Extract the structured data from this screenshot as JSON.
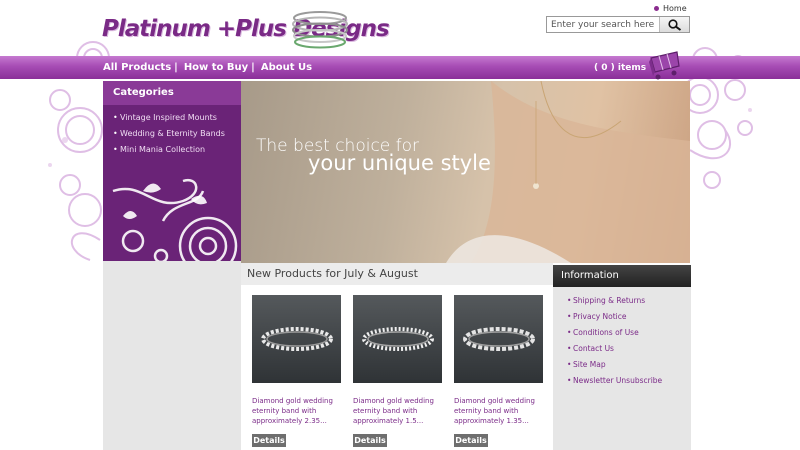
{
  "header": {
    "logo_text": "Platinum +Plus Designs",
    "home_link": "Home",
    "search_placeholder": "Enter your search here"
  },
  "nav": {
    "items": [
      {
        "label": "All Products"
      },
      {
        "label": "How to Buy"
      },
      {
        "label": "About Us"
      }
    ],
    "separator": "|",
    "cart_label": "( 0 ) items"
  },
  "categories": {
    "title": "Categories",
    "items": [
      {
        "label": "Vintage Inspired Mounts"
      },
      {
        "label": "Wedding & Eternity Bands"
      },
      {
        "label": "Mini Mania Collection"
      }
    ]
  },
  "banner": {
    "line1": "The best choice for",
    "line2": "your unique style"
  },
  "products": {
    "title": "New Products for July & August",
    "items": [
      {
        "name": "Diamond gold wedding eternity band with approximately 2.35...",
        "button": "Details"
      },
      {
        "name": "Diamond gold wedding eternity band with approximately 1.5...",
        "button": "Details"
      },
      {
        "name": "Diamond gold wedding eternity band with approximately 1.35...",
        "button": "Details"
      }
    ]
  },
  "information": {
    "title": "Information",
    "items": [
      {
        "label": "Shipping & Returns"
      },
      {
        "label": "Privacy Notice"
      },
      {
        "label": "Conditions of Use"
      },
      {
        "label": "Contact Us"
      },
      {
        "label": "Site Map"
      },
      {
        "label": "Newsletter Unsubscribe"
      }
    ]
  },
  "colors": {
    "brand_purple": "#8a2f99",
    "sidebar_purple": "#6a2377",
    "link_purple": "#7b2b88",
    "info_header": "#2a2a2a"
  }
}
